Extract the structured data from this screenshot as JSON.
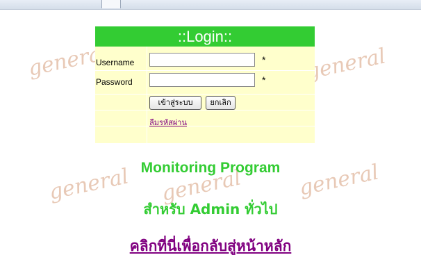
{
  "watermark": {
    "text": "general"
  },
  "login": {
    "title": "::Login::",
    "username_label": "Username",
    "password_label": "Password",
    "username_value": "",
    "password_value": "",
    "required_mark": "*",
    "submit_label": "เข้าสู่ระบบ",
    "cancel_label": "ยกเลิก",
    "forgot_label": "ลืมรหัสผ่าน"
  },
  "main": {
    "title": "Monitoring Program",
    "subtitle": "สำหรับ Admin ทั่วไป",
    "home_link": "คลิกที่นี่เพื่อกลับสู่หน้าหลัก"
  },
  "colors": {
    "header_green": "#33cc33",
    "panel_yellow": "#ffffcc",
    "link_purple": "#800080",
    "watermark": "#e8c9b6"
  }
}
